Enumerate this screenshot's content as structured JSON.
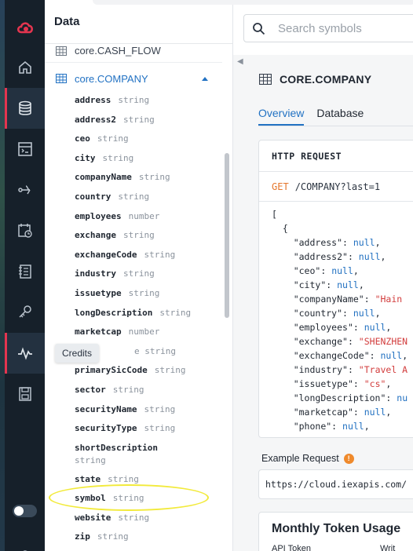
{
  "sidebar": {
    "items": [
      {
        "name": "logo",
        "icon": "cloud-logo-icon"
      },
      {
        "name": "home",
        "icon": "home-icon"
      },
      {
        "name": "data",
        "icon": "database-icon",
        "active": true
      },
      {
        "name": "console",
        "icon": "console-icon"
      },
      {
        "name": "rules",
        "icon": "branch-icon"
      },
      {
        "name": "schedule",
        "icon": "calendar-clock-icon"
      },
      {
        "name": "logs",
        "icon": "notebook-icon"
      },
      {
        "name": "keys",
        "icon": "key-icon"
      },
      {
        "name": "credits",
        "icon": "pulse-icon"
      },
      {
        "name": "storage",
        "icon": "save-icon"
      }
    ],
    "tooltip": "Credits"
  },
  "data_panel": {
    "title": "Data",
    "prev_table": "core.CASH_FLOW",
    "open_table": "core.COMPANY",
    "fields": [
      {
        "name": "address",
        "type": "string"
      },
      {
        "name": "address2",
        "type": "string"
      },
      {
        "name": "ceo",
        "type": "string"
      },
      {
        "name": "city",
        "type": "string"
      },
      {
        "name": "companyName",
        "type": "string"
      },
      {
        "name": "country",
        "type": "string"
      },
      {
        "name": "employees",
        "type": "number"
      },
      {
        "name": "exchange",
        "type": "string"
      },
      {
        "name": "exchangeCode",
        "type": "string"
      },
      {
        "name": "industry",
        "type": "string"
      },
      {
        "name": "issuetype",
        "type": "string"
      },
      {
        "name": "longDescription",
        "type": "string"
      },
      {
        "name": "marketcap",
        "type": "number"
      },
      {
        "name": "",
        "type": "e string",
        "partial": true
      },
      {
        "name": "primarySicCode",
        "type": "string"
      },
      {
        "name": "sector",
        "type": "string"
      },
      {
        "name": "securityName",
        "type": "string"
      },
      {
        "name": "securityType",
        "type": "string"
      },
      {
        "name": "shortDescription",
        "type": "string",
        "wrap": true
      },
      {
        "name": "state",
        "type": "string"
      },
      {
        "name": "symbol",
        "type": "string",
        "highlighted": true
      },
      {
        "name": "website",
        "type": "string"
      },
      {
        "name": "zip",
        "type": "string"
      }
    ]
  },
  "search": {
    "placeholder": "Search symbols"
  },
  "main": {
    "title": "CORE.COMPANY",
    "tabs": [
      "Overview",
      "Database"
    ],
    "active_tab": "Overview",
    "http_header": "HTTP REQUEST",
    "request_method": "GET",
    "request_path": "/COMPANY?last=1",
    "response_lines": [
      {
        "text": "[",
        "kind": "plain"
      },
      {
        "text": "  {",
        "kind": "plain"
      },
      {
        "key": "address",
        "value": "null",
        "kind": "null"
      },
      {
        "key": "address2",
        "value": "null",
        "kind": "null"
      },
      {
        "key": "ceo",
        "value": "null",
        "kind": "null"
      },
      {
        "key": "city",
        "value": "null",
        "kind": "null"
      },
      {
        "key": "companyName",
        "value": "\"Hain",
        "kind": "str"
      },
      {
        "key": "country",
        "value": "null",
        "kind": "null"
      },
      {
        "key": "employees",
        "value": "null",
        "kind": "null"
      },
      {
        "key": "exchange",
        "value": "\"SHENZHEN",
        "kind": "str"
      },
      {
        "key": "exchangeCode",
        "value": "null",
        "kind": "null"
      },
      {
        "key": "industry",
        "value": "\"Travel A",
        "kind": "str"
      },
      {
        "key": "issuetype",
        "value": "\"cs\"",
        "kind": "str"
      },
      {
        "key": "longDescription",
        "value": "nu",
        "kind": "null"
      },
      {
        "key": "marketcap",
        "value": "null",
        "kind": "null"
      },
      {
        "key": "phone",
        "value": "null",
        "kind": "null"
      }
    ],
    "example_label": "Example Request",
    "example_url": "https://cloud.iexapis.com/",
    "usage_title": "Monthly Token Usage",
    "usage_col1": "API Token",
    "usage_col2": "Writ"
  },
  "colors": {
    "accent": "#2272c3",
    "brand": "#e4354f",
    "rail_bg": "#16202a",
    "highlight": "#f2ea3b",
    "get_method": "#e5772d"
  }
}
